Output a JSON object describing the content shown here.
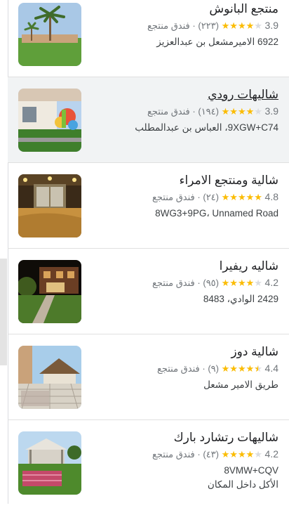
{
  "results": [
    {
      "name": "منتجع البانوش",
      "rating": "3.9",
      "stars": [
        "full",
        "full",
        "full",
        "full",
        "empty"
      ],
      "reviews": "(٢٢٣)",
      "category": "فندق منتجع",
      "address": "6922 الاميرمشعل بن عبدالعزيز",
      "extra": ""
    },
    {
      "name": "شاليهات رودي",
      "rating": "3.9",
      "stars": [
        "full",
        "full",
        "full",
        "full",
        "empty"
      ],
      "reviews": "(١٩٤)",
      "category": "فندق منتجع",
      "address": "9XGW+C74، العباس بن عبدالمطلب",
      "extra": ""
    },
    {
      "name": "شالية ومنتجع الامراء",
      "rating": "4.8",
      "stars": [
        "full",
        "full",
        "full",
        "full",
        "full"
      ],
      "reviews": "(٢٤)",
      "category": "فندق منتجع",
      "address": "8WG3+9PG، Unnamed Road",
      "extra": ""
    },
    {
      "name": "شاليه ريفيرا",
      "rating": "4.2",
      "stars": [
        "full",
        "full",
        "full",
        "full",
        "empty"
      ],
      "reviews": "(٩٥)",
      "category": "فندق منتجع",
      "address": "2429 الوادي، 8483",
      "extra": ""
    },
    {
      "name": "شالية دوز",
      "rating": "4.4",
      "stars": [
        "full",
        "full",
        "full",
        "full",
        "half"
      ],
      "reviews": "(٩)",
      "category": "فندق منتجع",
      "address": "طريق الامير مشعل",
      "extra": ""
    },
    {
      "name": "شاليهات رتشارد بارك",
      "rating": "4.2",
      "stars": [
        "full",
        "full",
        "full",
        "full",
        "empty"
      ],
      "reviews": "(٤٣)",
      "category": "فندق منتجع",
      "address": "8VMW+CQV",
      "extra": "الأكل داخل المكان"
    }
  ],
  "separator": "·",
  "colors": {
    "star": "#fbbc04",
    "star_empty": "#dadce0",
    "hover_bg": "#f1f3f4"
  }
}
